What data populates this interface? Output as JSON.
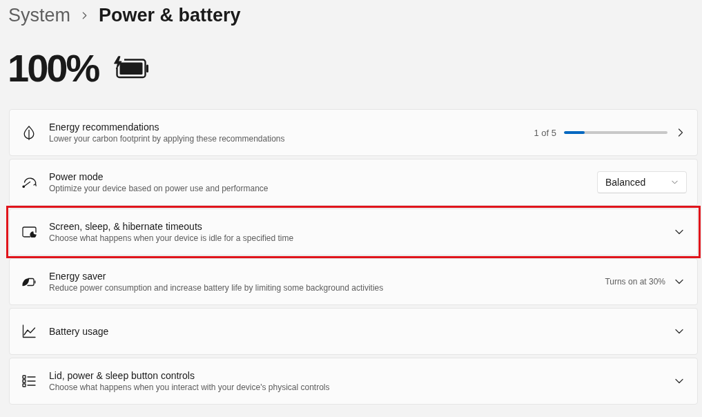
{
  "breadcrumb": {
    "parent": "System",
    "current": "Power & battery"
  },
  "battery": {
    "percentage": "100%",
    "charging": true
  },
  "settings": [
    {
      "kind": "progress",
      "title": "Energy recommendations",
      "description": "Lower your carbon footprint by applying these recommendations",
      "progress_label": "1 of 5",
      "level": 0.2,
      "highlighted": false
    },
    {
      "kind": "dropdown",
      "title": "Power mode",
      "description": "Optimize your device based on power use and performance",
      "value": "Balanced",
      "highlighted": false
    },
    {
      "kind": "expander",
      "title": "Screen, sleep, & hibernate timeouts",
      "description": "Choose what happens when your device is idle for a specified time",
      "expanded": false,
      "highlighted": true
    },
    {
      "kind": "expander",
      "title": "Energy saver",
      "description": "Reduce power consumption and increase battery life by limiting some background activities",
      "status": "Turns on at 30%",
      "expanded": false,
      "highlighted": false
    },
    {
      "kind": "expander",
      "title": "Battery usage",
      "expanded": false,
      "highlighted": false
    },
    {
      "kind": "expander",
      "title": "Lid, power & sleep button controls",
      "description": "Choose what happens when you interact with your device's physical controls",
      "expanded": false,
      "highlighted": false
    }
  ]
}
